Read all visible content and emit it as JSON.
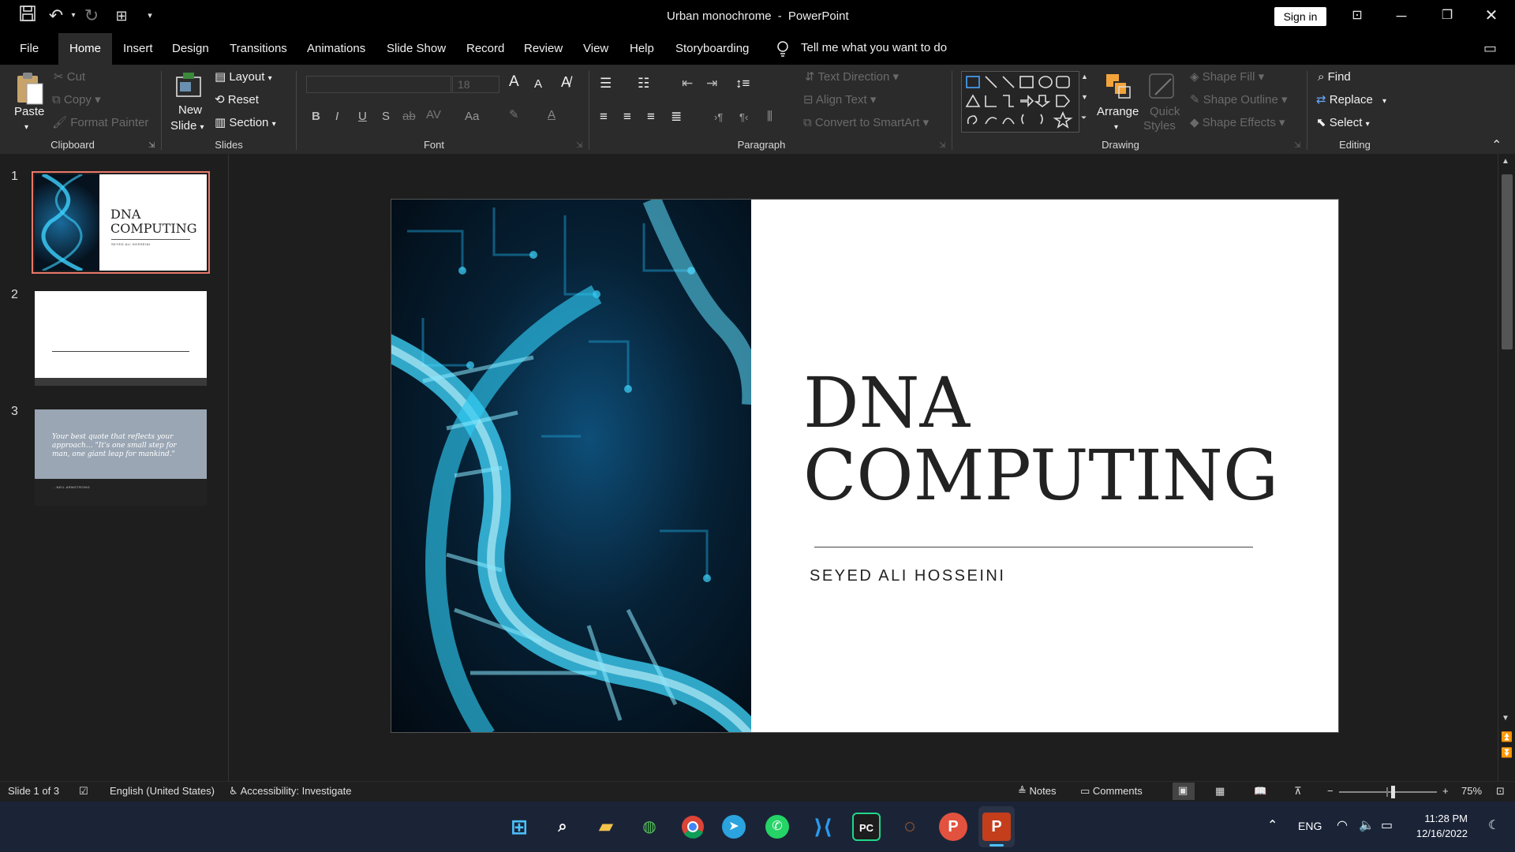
{
  "window": {
    "doc_title": "Urban monochrome",
    "separator": "-",
    "app_name": "PowerPoint",
    "sign_in": "Sign in"
  },
  "tabs": [
    "File",
    "Home",
    "Insert",
    "Design",
    "Transitions",
    "Animations",
    "Slide Show",
    "Record",
    "Review",
    "View",
    "Help",
    "Storyboarding"
  ],
  "tell_me": "Tell me what you want to do",
  "ribbon": {
    "clipboard": {
      "paste": "Paste",
      "cut": "Cut",
      "copy": "Copy",
      "format_painter": "Format Painter",
      "label": "Clipboard"
    },
    "slides": {
      "new_slide_1": "New",
      "new_slide_2": "Slide",
      "layout": "Layout",
      "reset": "Reset",
      "section": "Section",
      "label": "Slides"
    },
    "font": {
      "size": "18",
      "label": "Font",
      "grow": "A",
      "shrink": "A",
      "case": "Aa"
    },
    "paragraph": {
      "text_direction": "Text Direction",
      "align_text": "Align Text",
      "convert_smartart": "Convert to SmartArt",
      "label": "Paragraph"
    },
    "drawing": {
      "arrange": "Arrange",
      "quick_styles_1": "Quick",
      "quick_styles_2": "Styles",
      "shape_fill": "Shape Fill",
      "shape_outline": "Shape Outline",
      "shape_effects": "Shape Effects",
      "label": "Drawing"
    },
    "editing": {
      "find": "Find",
      "replace": "Replace",
      "select": "Select",
      "label": "Editing"
    }
  },
  "thumbnails": [
    {
      "num": "1",
      "title_1": "DNA",
      "title_2": "COMPUTING",
      "subtitle": "SEYED ALI HOSSEINI"
    },
    {
      "num": "2"
    },
    {
      "num": "3",
      "quote": "Your best quote that reflects your approach… \"It's one small step for man, one giant leap for mankind.\"",
      "author": "- NEIL ARMSTRONG"
    }
  ],
  "slide": {
    "title_line1": "DNA",
    "title_line2": "COMPUTING",
    "subtitle": "SEYED ALI HOSSEINI"
  },
  "status": {
    "slide_info": "Slide 1 of 3",
    "language": "English (United States)",
    "accessibility": "Accessibility: Investigate",
    "notes": "Notes",
    "comments": "Comments",
    "zoom": "75%",
    "zoom_minus": "−",
    "zoom_plus": "+",
    "zoom_fraction": 0.55
  },
  "taskbar": {
    "language": "ENG",
    "time": "11:28 PM",
    "date": "12/16/2022"
  },
  "colors": {
    "accent": "#c43e1c",
    "selection": "#e8786a",
    "ribbon": "#2b2b2b",
    "dna": "#2ec8f0"
  }
}
